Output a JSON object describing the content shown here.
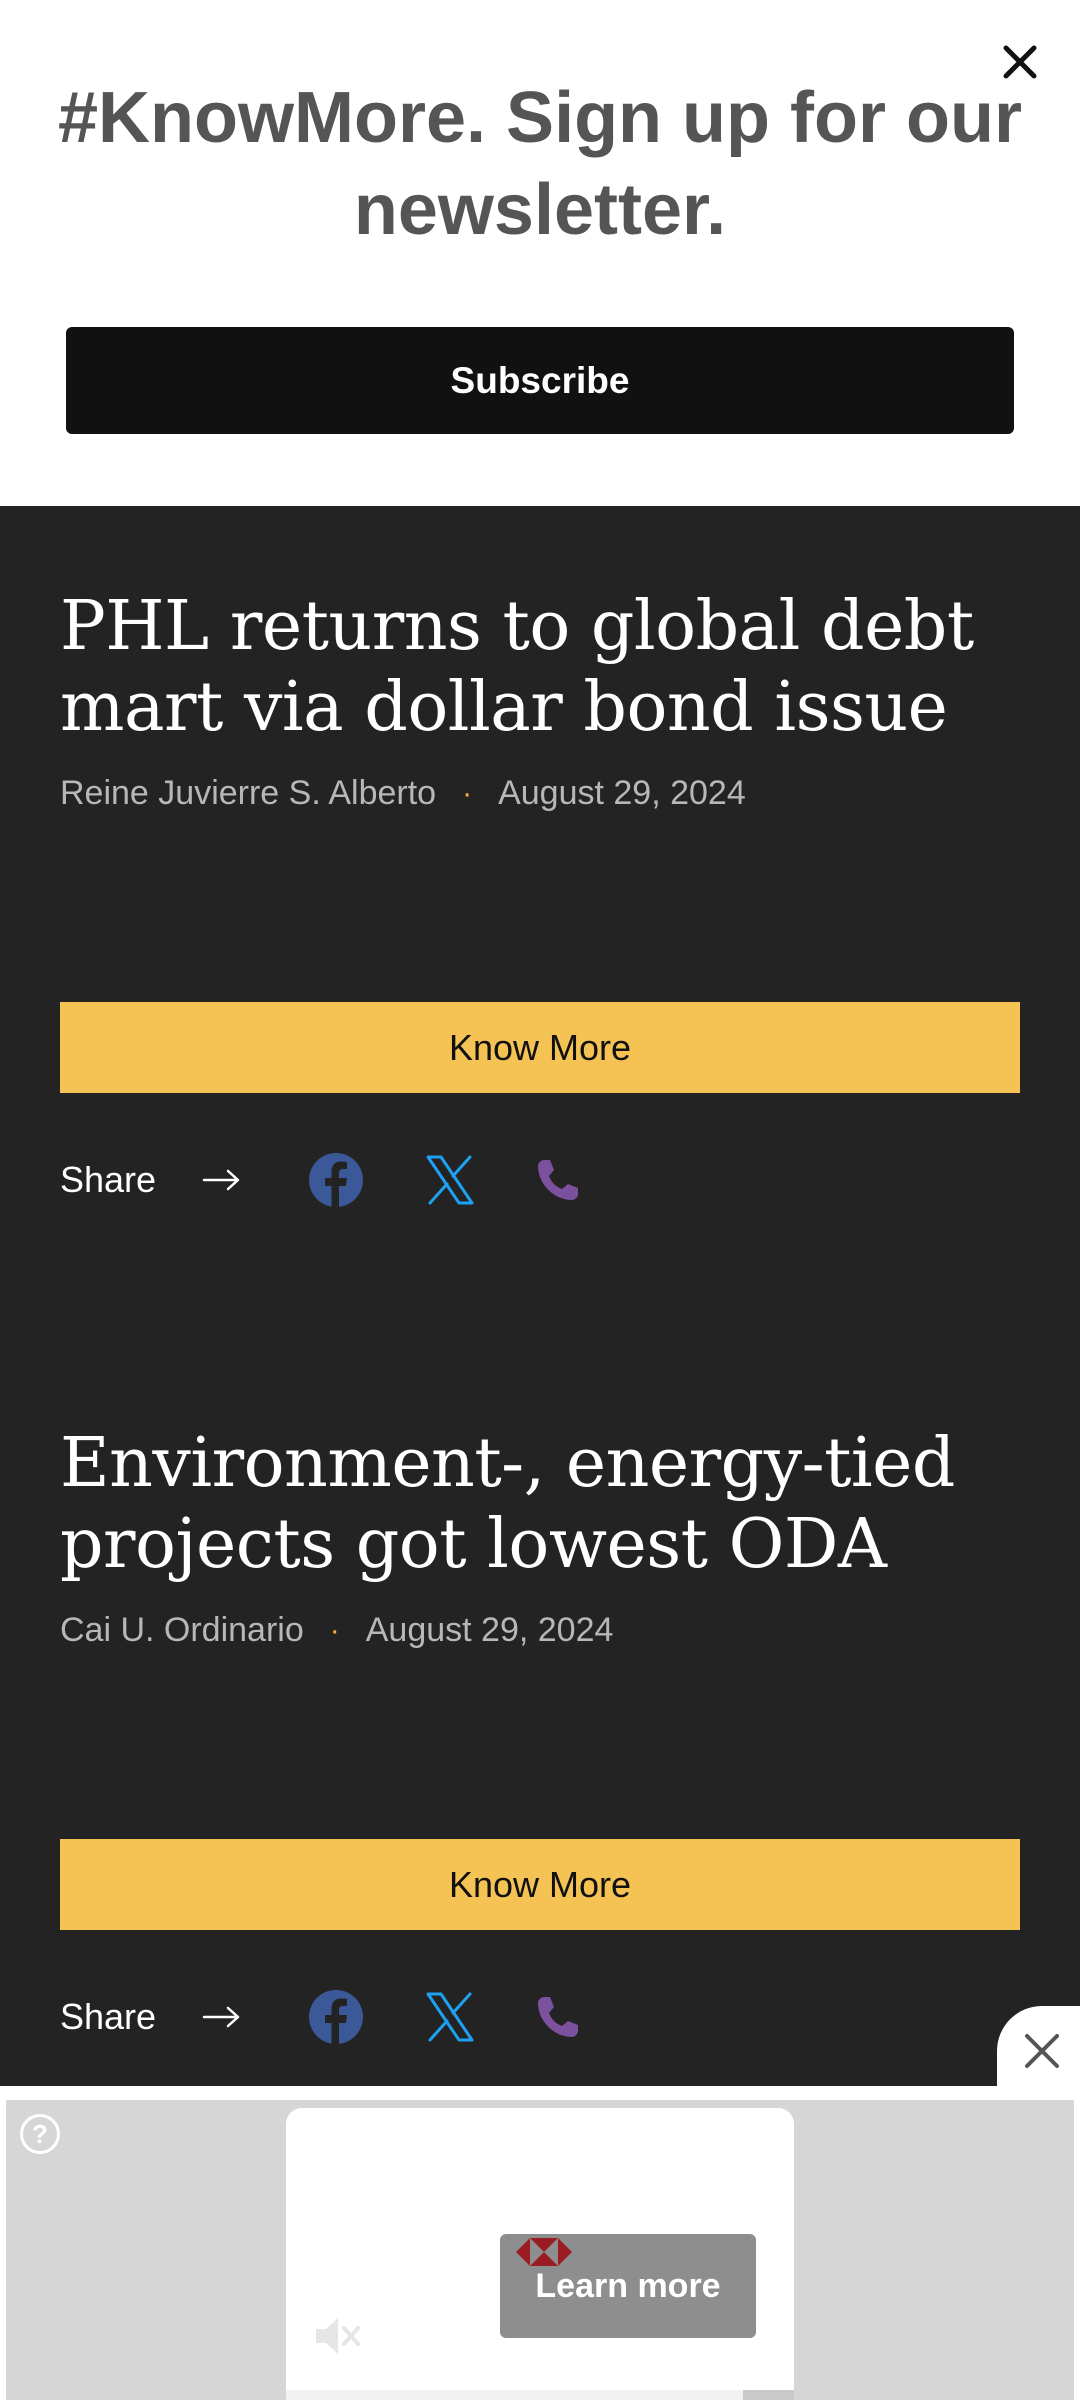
{
  "newsletter": {
    "title": "#KnowMore. Sign up for our newsletter.",
    "subscribe_label": "Subscribe"
  },
  "articles": [
    {
      "title": "PHL returns to global debt mart via dollar bond issue",
      "author": "Reine Juvierre S. Alberto",
      "separator": "·",
      "date": "August 29, 2024",
      "cta_label": "Know More",
      "share_label": "Share"
    },
    {
      "title": "Environment-, energy-tied projects got lowest ODA",
      "author": "Cai U. Ordinario",
      "separator": "·",
      "date": "August 29, 2024",
      "cta_label": "Know More",
      "share_label": "Share"
    }
  ],
  "share_icons": [
    "facebook-icon",
    "x-twitter-icon",
    "phone-icon"
  ],
  "ad": {
    "help_glyph": "?",
    "learn_more_label": "Learn more",
    "progress": 0.9
  },
  "colors": {
    "background": "#232323",
    "accent": "#f5c254",
    "facebook": "#3b5998",
    "x_twitter": "#1da1f2",
    "phone": "#7b519d"
  }
}
